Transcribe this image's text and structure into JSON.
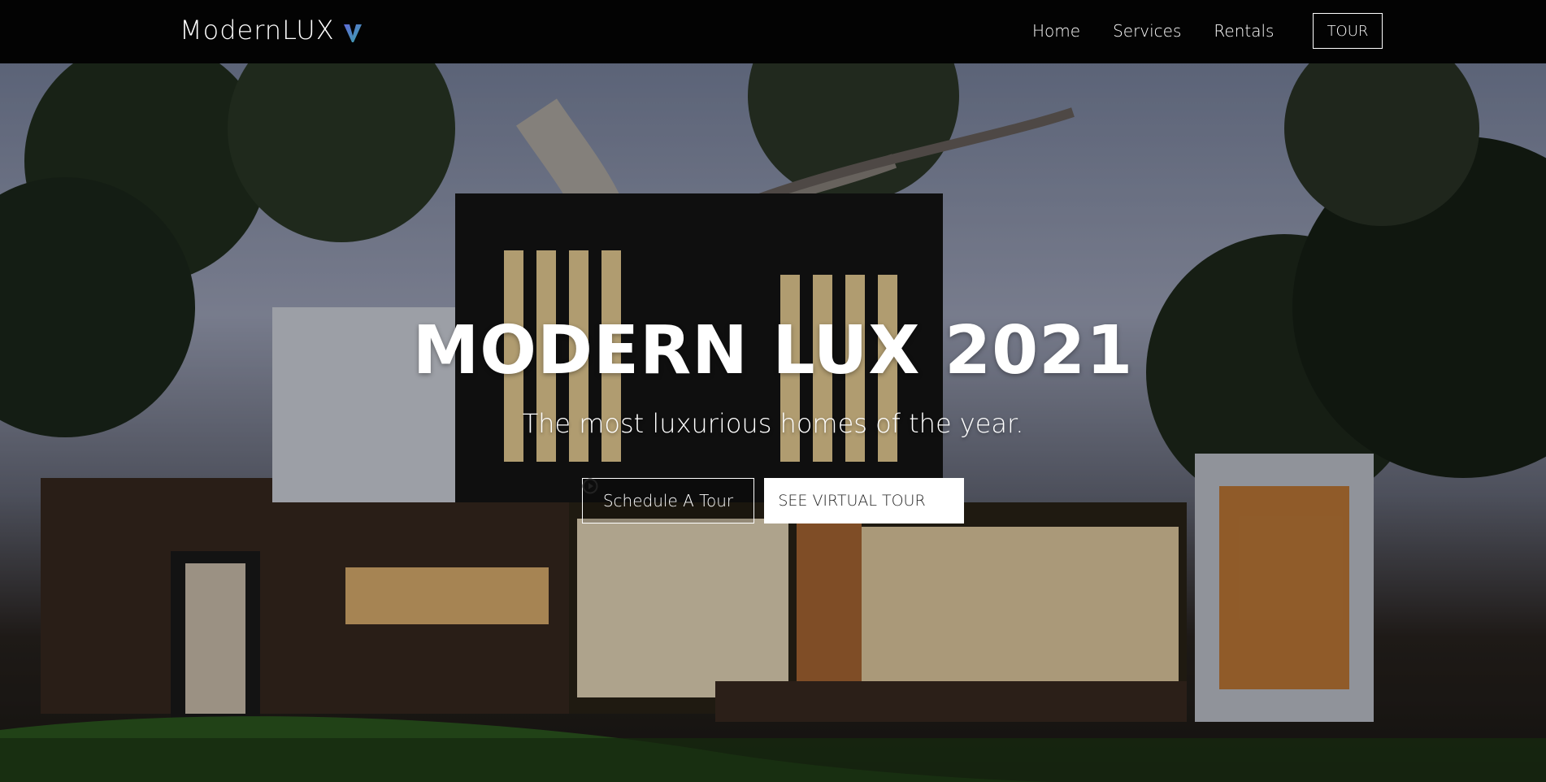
{
  "brand": {
    "name": "ModernLUX",
    "icon": "v-logo-icon",
    "accent": "#3aa3a8"
  },
  "nav": {
    "links": [
      "Home",
      "Services",
      "Rentals"
    ],
    "cta": "TOUR"
  },
  "hero": {
    "title": "MODERN LUX 2021",
    "subtitle": "The most luxurious homes of the year.",
    "primary_button": "Schedule A Tour",
    "secondary_button": "SEE VIRTUAL TOUR",
    "secondary_icon": "play-circle-icon"
  },
  "colors": {
    "nav_bg": "#030303",
    "text": "#ffffff",
    "button_text_dark": "#222222"
  }
}
